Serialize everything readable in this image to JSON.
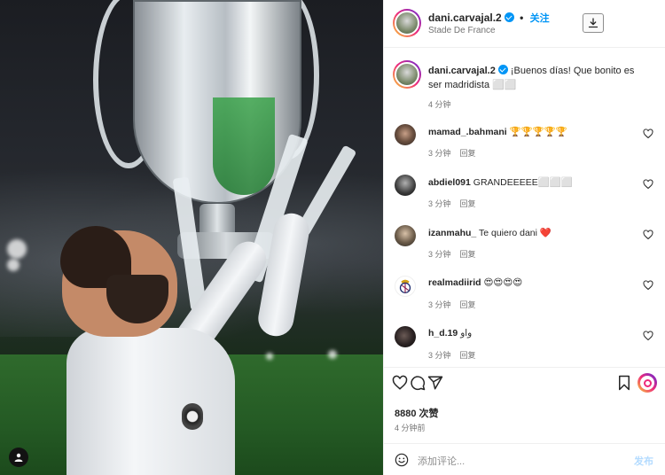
{
  "post": {
    "photo_alt": "",
    "header": {
      "username": "dani.carvajal.2",
      "follow_label": "关注",
      "separator": "•",
      "location": "Stade De France"
    },
    "caption": {
      "username": "dani.carvajal.2",
      "text": "¡Buenos días! Que bonito es ser madridista ⬜⬜",
      "time": "4 分钟"
    },
    "comments": [
      {
        "username": "mamad_.bahmani",
        "text": "🏆🏆🏆🏆🏆",
        "time": "3 分钟",
        "reply": "回复"
      },
      {
        "username": "abdiel091",
        "text": "GRANDEEEEE⬜⬜⬜",
        "time": "3 分钟",
        "reply": "回复"
      },
      {
        "username": "izanmahu_",
        "text": "Te quiero dani ❤️",
        "time": "3 分钟",
        "reply": "回复"
      },
      {
        "username": "realmadiirid",
        "text": "😍😍😍😍",
        "time": "3 分钟",
        "reply": "回复"
      },
      {
        "username": "h_d.19",
        "text": "واو",
        "time": "3 分钟",
        "reply": "回复"
      }
    ],
    "likes_text": "8880 次赞",
    "posted_ago": "4 分钟前",
    "add_comment": {
      "placeholder": "添加评论...",
      "post_label": "发布"
    }
  },
  "colors": {
    "accent": "#0095f6",
    "text": "#262626",
    "muted": "#737373",
    "post_button_disabled": "#b3dbff"
  },
  "icons": {
    "verified": "verified-badge-icon",
    "download": "download-icon",
    "like": "heart-icon",
    "comment": "comment-icon",
    "share": "share-icon",
    "save": "bookmark-icon",
    "emoji": "emoji-icon",
    "user_tags": "user-tag-icon"
  }
}
